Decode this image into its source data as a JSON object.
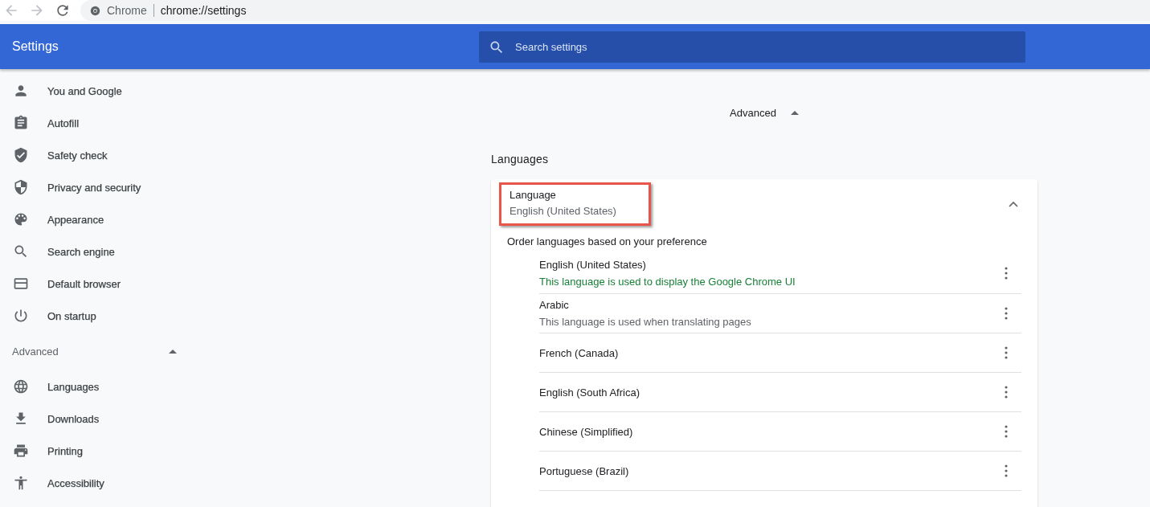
{
  "browser": {
    "site_label": "Chrome",
    "url": "chrome://settings"
  },
  "header": {
    "title": "Settings",
    "search": {
      "placeholder": "Search settings"
    }
  },
  "sidebar": {
    "items": [
      {
        "label": "You and Google"
      },
      {
        "label": "Autofill"
      },
      {
        "label": "Safety check"
      },
      {
        "label": "Privacy and security"
      },
      {
        "label": "Appearance"
      },
      {
        "label": "Search engine"
      },
      {
        "label": "Default browser"
      },
      {
        "label": "On startup"
      }
    ],
    "advanced": {
      "label": "Advanced",
      "expanded": true,
      "items": [
        {
          "label": "Languages"
        },
        {
          "label": "Downloads"
        },
        {
          "label": "Printing"
        },
        {
          "label": "Accessibility"
        }
      ]
    }
  },
  "main": {
    "advanced": {
      "label": "Advanced",
      "expanded": true
    },
    "section_title": "Languages",
    "card": {
      "title": "Language",
      "value": "English (United States)",
      "highlighted": true,
      "expanded": true,
      "order_label": "Order languages based on your preference",
      "languages": [
        {
          "name": "English (United States)",
          "note": "This language is used to display the Google Chrome UI",
          "kind": "ui"
        },
        {
          "name": "Arabic",
          "note": "This language is used when translating pages",
          "kind": "translate"
        },
        {
          "name": "French (Canada)"
        },
        {
          "name": "English (South Africa)"
        },
        {
          "name": "Chinese (Simplified)"
        },
        {
          "name": "Portuguese (Brazil)"
        }
      ]
    }
  }
}
